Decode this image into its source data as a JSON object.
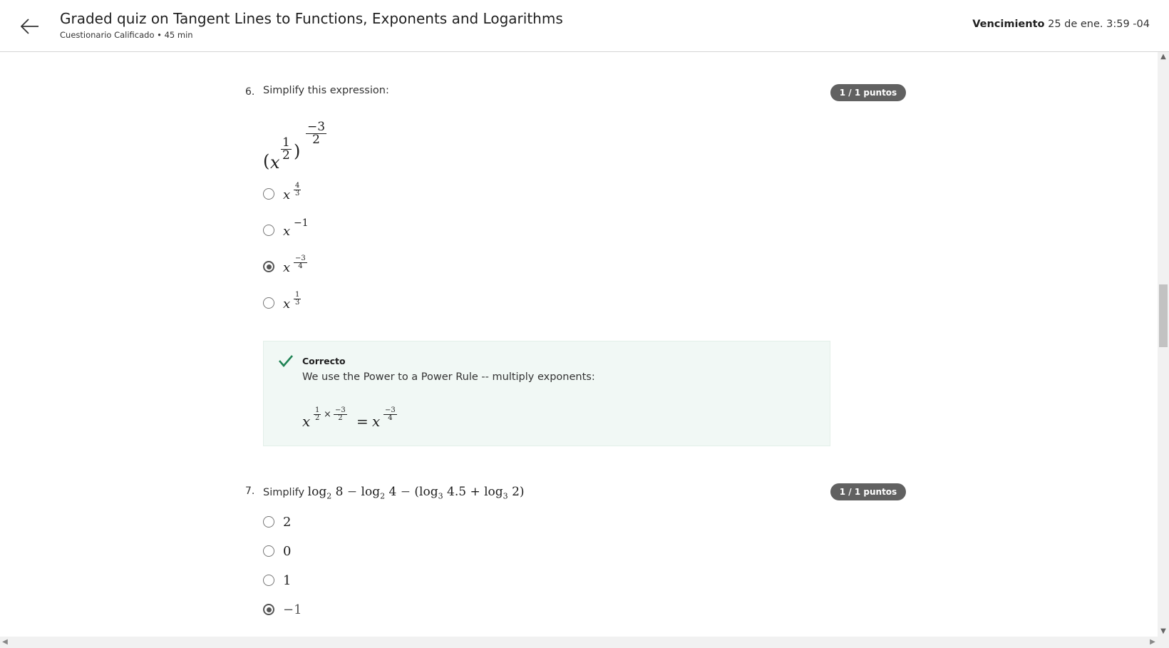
{
  "header": {
    "title": "Graded quiz on Tangent Lines to Functions, Exponents and Logarithms",
    "subtitle": "Cuestionario Calificado • 45 min",
    "due_label": "Vencimiento",
    "due_value": "25 de ene. 3:59 -04",
    "back_icon": "arrow-left-icon"
  },
  "questions": [
    {
      "number": "6.",
      "prompt": "Simplify this expression:",
      "points": "1 / 1 puntos",
      "expression": {
        "base": "x",
        "inner_num": "1",
        "inner_den": "2",
        "outer_num": "−3",
        "outer_den": "2"
      },
      "options": [
        {
          "base": "x",
          "exp_num": "4",
          "exp_den": "3",
          "selected": false
        },
        {
          "base": "x",
          "exp": "−1",
          "selected": false
        },
        {
          "base": "x",
          "exp_num": "−3",
          "exp_den": "4",
          "selected": true
        },
        {
          "base": "x",
          "exp_num": "1",
          "exp_den": "3",
          "selected": false
        }
      ],
      "feedback": {
        "status": "Correcto",
        "text": "We use the Power to a Power Rule -- multiply exponents:",
        "math": {
          "base": "x",
          "a_num": "1",
          "a_den": "2",
          "times": "×",
          "b_num": "−3",
          "b_den": "2",
          "equals": "=",
          "r_num": "−3",
          "r_den": "4"
        },
        "icon": "checkmark-icon",
        "accent_color": "#1f8354"
      }
    },
    {
      "number": "7.",
      "prompt": "Simplify",
      "prompt_math": {
        "log": "log",
        "b1": "2",
        "a1": "8",
        "minus1": "−",
        "b2": "2",
        "a2": "4",
        "minus2": "−",
        "lparen": "(",
        "b3": "3",
        "a3": "4.5",
        "plus": "+",
        "b4": "3",
        "a4": "2",
        "rparen": ")"
      },
      "points": "1 / 1 puntos",
      "options": [
        {
          "label": "2",
          "selected": false
        },
        {
          "label": "0",
          "selected": false
        },
        {
          "label": "1",
          "selected": false
        },
        {
          "label": "−1",
          "selected": true
        }
      ]
    }
  ],
  "scrollbar": {
    "up": "▲",
    "down": "▼",
    "left": "◀",
    "right": "▶"
  }
}
